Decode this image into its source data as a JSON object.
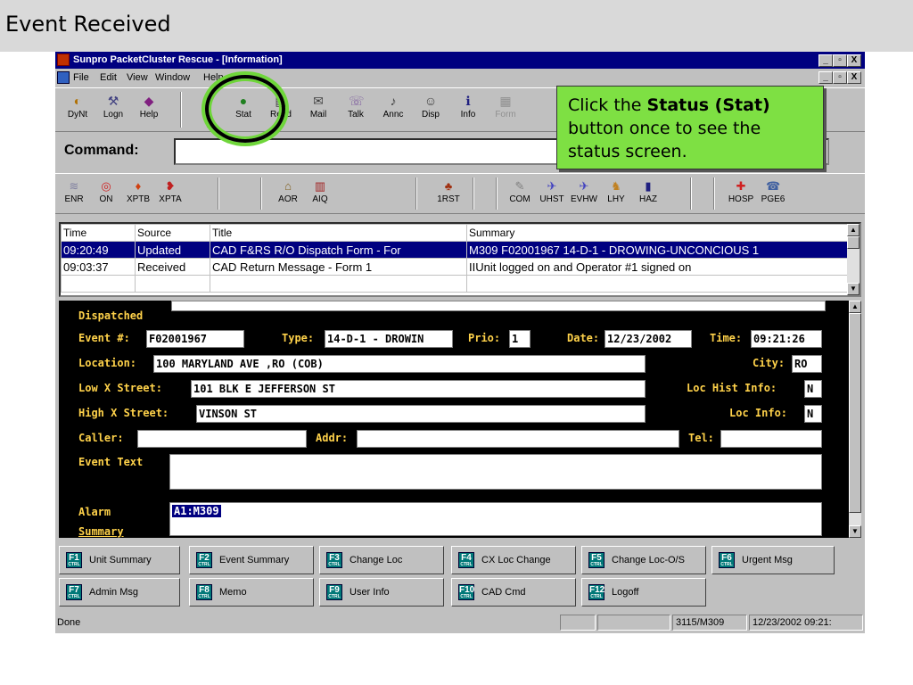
{
  "slide": {
    "title": "Event Received"
  },
  "window": {
    "title": "Sunpro PacketCluster Rescue - [Information]",
    "controls": [
      "_",
      "▫",
      "X"
    ]
  },
  "menu": [
    "File",
    "Edit",
    "View",
    "Window",
    "Help"
  ],
  "toolbar1": [
    {
      "label": "DyNt",
      "icon": "dispatch-icon",
      "glyph": "◐"
    },
    {
      "label": "Logn",
      "icon": "login-icon",
      "glyph": "⚒"
    },
    {
      "label": "Help",
      "icon": "help-icon",
      "glyph": "◆"
    },
    {
      "label": "Stat",
      "icon": "traffic-light-icon",
      "glyph": "●"
    },
    {
      "label": "Read",
      "icon": "read-icon",
      "glyph": "▤"
    },
    {
      "label": "Mail",
      "icon": "mail-icon",
      "glyph": "✉"
    },
    {
      "label": "Talk",
      "icon": "talk-icon",
      "glyph": "☏"
    },
    {
      "label": "Annc",
      "icon": "announce-icon",
      "glyph": "♪"
    },
    {
      "label": "Disp",
      "icon": "display-icon",
      "glyph": "☺"
    },
    {
      "label": "Info",
      "icon": "info-icon",
      "glyph": "ℹ"
    },
    {
      "label": "Form",
      "icon": "form-icon",
      "glyph": "▦"
    }
  ],
  "command": {
    "label": "Command:",
    "value": ""
  },
  "toolbar2": [
    {
      "label": "ENR",
      "icon": "enroute-icon",
      "glyph": "≋"
    },
    {
      "label": "ON",
      "icon": "onscene-icon",
      "glyph": "◎"
    },
    {
      "label": "XPTB",
      "icon": "transport-b-icon",
      "glyph": "♦"
    },
    {
      "label": "XPTA",
      "icon": "transport-a-icon",
      "glyph": "❥"
    },
    {
      "label": "AOR",
      "icon": "aor-icon",
      "glyph": "⌂"
    },
    {
      "label": "AIQ",
      "icon": "aiq-icon",
      "glyph": "▥"
    },
    {
      "label": "1RST",
      "icon": "first-icon",
      "glyph": "♣"
    },
    {
      "label": "COM",
      "icon": "com-icon",
      "glyph": "✎"
    },
    {
      "label": "UHST",
      "icon": "uhst-icon",
      "glyph": "✈"
    },
    {
      "label": "EVHW",
      "icon": "evhw-icon",
      "glyph": "✈"
    },
    {
      "label": "LHY",
      "icon": "lhy-icon",
      "glyph": "♞"
    },
    {
      "label": "HAZ",
      "icon": "hazard-icon",
      "glyph": "▮"
    },
    {
      "label": "HOSP",
      "icon": "hospital-icon",
      "glyph": "✚"
    },
    {
      "label": "PGE6",
      "icon": "page-icon",
      "glyph": "☎"
    }
  ],
  "messages": {
    "columns": [
      "Time",
      "Source",
      "Title",
      "Summary"
    ],
    "rows": [
      {
        "time": "09:20:49",
        "source": "Updated",
        "title": "CAD F&RS R/O Dispatch Form - For",
        "summary": "M309  F02001967 14-D-1 - DROWING-UNCONCIOUS 1"
      },
      {
        "time": "09:03:37",
        "source": "Received",
        "title": "CAD Return Message - Form 1",
        "summary": "IIUnit logged on and Operator #1 signed on"
      }
    ]
  },
  "detail": {
    "dispatched_label": "Dispatched",
    "event_label": "Event #:",
    "event": "F02001967",
    "type_label": "Type:",
    "type": "14-D-1 - DROWIN",
    "prio_label": "Prio:",
    "prio": "1",
    "date_label": "Date:",
    "date": "12/23/2002",
    "time_label": "Time:",
    "time": "09:21:26",
    "location_label": "Location:",
    "location": "100 MARYLAND AVE ,RO (COB)",
    "city_label": "City:",
    "city": "RO",
    "low_label": "Low X Street:",
    "low": "101 BLK E JEFFERSON ST",
    "lochist_label": "Loc Hist Info:",
    "lochist": "N",
    "high_label": "High X Street:",
    "high": "VINSON ST",
    "locinfo_label": "Loc Info:",
    "locinfo": "N",
    "caller_label": "Caller:",
    "caller": "",
    "addr_label": "Addr:",
    "addr": "",
    "tel_label": "Tel:",
    "tel": "",
    "eventtext_label": "Event Text",
    "eventtext": "",
    "alarm_label": "Alarm",
    "alarm": "A1:M309",
    "summary_label": "Summary"
  },
  "fkeys": [
    {
      "key": "F1",
      "label": "Unit Summary"
    },
    {
      "key": "F2",
      "label": "Event Summary"
    },
    {
      "key": "F3",
      "label": "Change Loc"
    },
    {
      "key": "F4",
      "label": "CX Loc Change"
    },
    {
      "key": "F5",
      "label": "Change Loc-O/S"
    },
    {
      "key": "F6",
      "label": "Urgent Msg"
    },
    {
      "key": "F7",
      "label": "Admin Msg"
    },
    {
      "key": "F8",
      "label": "Memo"
    },
    {
      "key": "F9",
      "label": "User Info"
    },
    {
      "key": "F10",
      "label": "CAD Cmd"
    },
    {
      "key": "F12",
      "label": "Logoff"
    }
  ],
  "fkey_modifier": "CTRL",
  "statusbar": {
    "left": "Done",
    "unit": "3115/M309",
    "datetime": "12/23/2002 09:21:"
  },
  "callout": {
    "pre": "Click the ",
    "bold": "Status (Stat)",
    "post": " button once to see the status screen."
  },
  "colors": {
    "titlebar": "#000080",
    "detail_bg": "#000000",
    "detail_label": "#ffd24a",
    "callout": "#7ee043",
    "highlight_ring": "#6fd63a"
  }
}
